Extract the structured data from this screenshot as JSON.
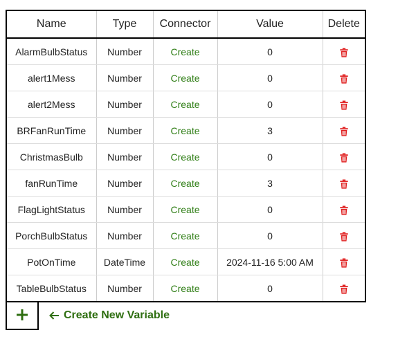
{
  "table": {
    "headers": [
      "Name",
      "Type",
      "Connector",
      "Value",
      "Delete"
    ],
    "rows": [
      {
        "name": "AlarmBulbStatus",
        "type": "Number",
        "connector": "Create",
        "value": "0",
        "highlight": false
      },
      {
        "name": "alert1Mess",
        "type": "Number",
        "connector": "Create",
        "value": "0",
        "highlight": false
      },
      {
        "name": "alert2Mess",
        "type": "Number",
        "connector": "Create",
        "value": "0",
        "highlight": false
      },
      {
        "name": "BRFanRunTime",
        "type": "Number",
        "connector": "Create",
        "value": "3",
        "highlight": true
      },
      {
        "name": "ChristmasBulb",
        "type": "Number",
        "connector": "Create",
        "value": "0",
        "highlight": false
      },
      {
        "name": "fanRunTime",
        "type": "Number",
        "connector": "Create",
        "value": "3",
        "highlight": true
      },
      {
        "name": "FlagLightStatus",
        "type": "Number",
        "connector": "Create",
        "value": "0",
        "highlight": false
      },
      {
        "name": "PorchBulbStatus",
        "type": "Number",
        "connector": "Create",
        "value": "0",
        "highlight": false
      },
      {
        "name": "PotOnTime",
        "type": "DateTime",
        "connector": "Create",
        "value": "2024-11-16 5:00 AM",
        "highlight": false
      },
      {
        "name": "TableBulbStatus",
        "type": "Number",
        "connector": "Create",
        "value": "0",
        "highlight": false
      }
    ]
  },
  "footer": {
    "add_icon": "plus-icon",
    "create_label": "Create New Variable",
    "arrow_icon": "arrow-left-icon"
  },
  "colors": {
    "highlight_name": "#f0a22e",
    "connector_link": "#2e7d14",
    "value_text": "#7a1a8a",
    "delete_icon": "#e02020",
    "create_hint": "#2e6e10"
  }
}
